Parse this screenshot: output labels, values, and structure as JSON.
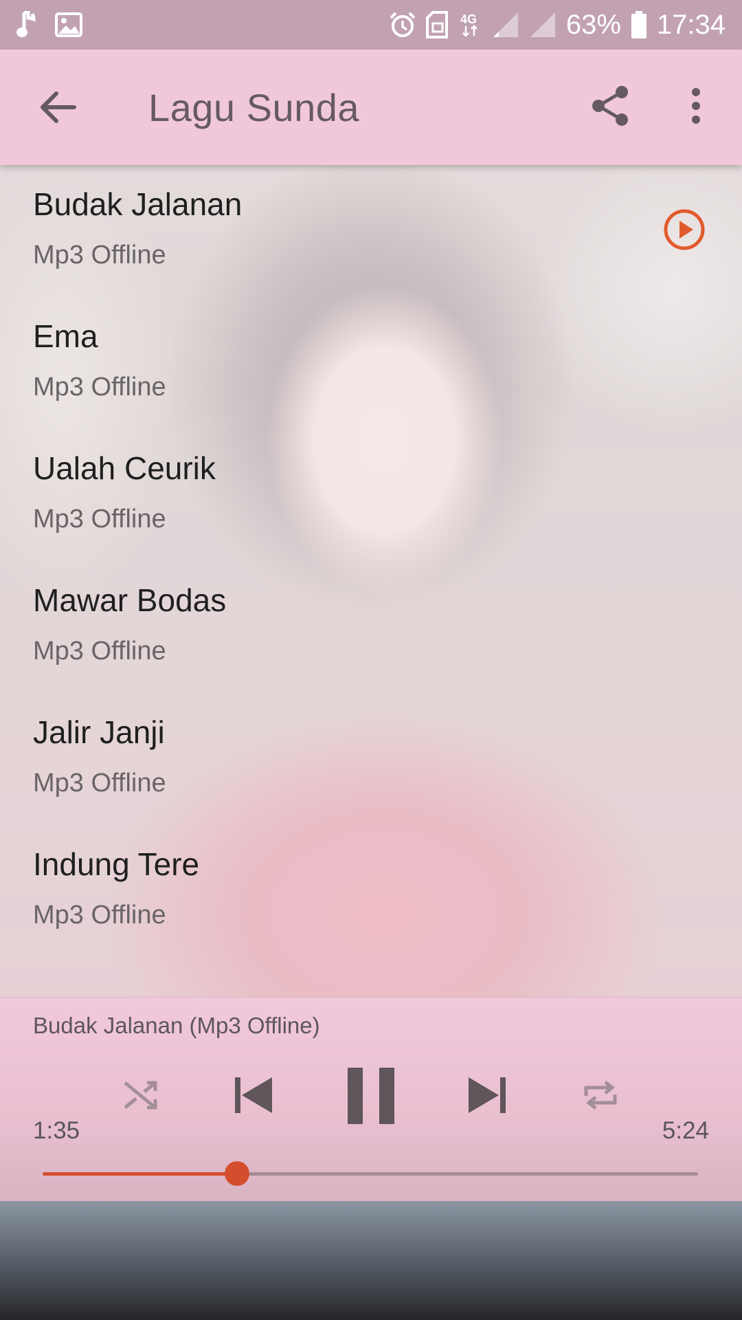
{
  "status_bar": {
    "battery_percent": "63%",
    "time": "17:34",
    "network": "4G",
    "icons": [
      "music-note-icon",
      "image-icon",
      "alarm-icon",
      "sim-icon",
      "signal-icon",
      "battery-icon"
    ]
  },
  "toolbar": {
    "title": "Lagu Sunda",
    "back_icon": "arrow-left-icon",
    "share_icon": "share-icon",
    "more_icon": "more-vert-icon"
  },
  "songs": [
    {
      "title": "Budak Jalanan",
      "subtitle": "Mp3 Offline",
      "playing": true
    },
    {
      "title": "Ema",
      "subtitle": "Mp3 Offline",
      "playing": false
    },
    {
      "title": "Ualah Ceurik",
      "subtitle": "Mp3 Offline",
      "playing": false
    },
    {
      "title": "Mawar Bodas",
      "subtitle": "Mp3 Offline",
      "playing": false
    },
    {
      "title": "Jalir Janji",
      "subtitle": "Mp3 Offline",
      "playing": false
    },
    {
      "title": "Indung Tere",
      "subtitle": "Mp3 Offline",
      "playing": false
    }
  ],
  "player": {
    "now_playing": "Budak Jalanan (Mp3 Offline)",
    "elapsed": "1:35",
    "total": "5:24",
    "progress_fraction": 0.2965,
    "state": "playing",
    "controls": [
      "shuffle-icon",
      "skip-previous-icon",
      "pause-icon",
      "skip-next-icon",
      "repeat-icon"
    ]
  },
  "colors": {
    "accent": "#d44e2e",
    "toolbar_bg": "#f1c8da",
    "status_bar_bg": "#c2a2b2",
    "title_text": "#665a62"
  }
}
